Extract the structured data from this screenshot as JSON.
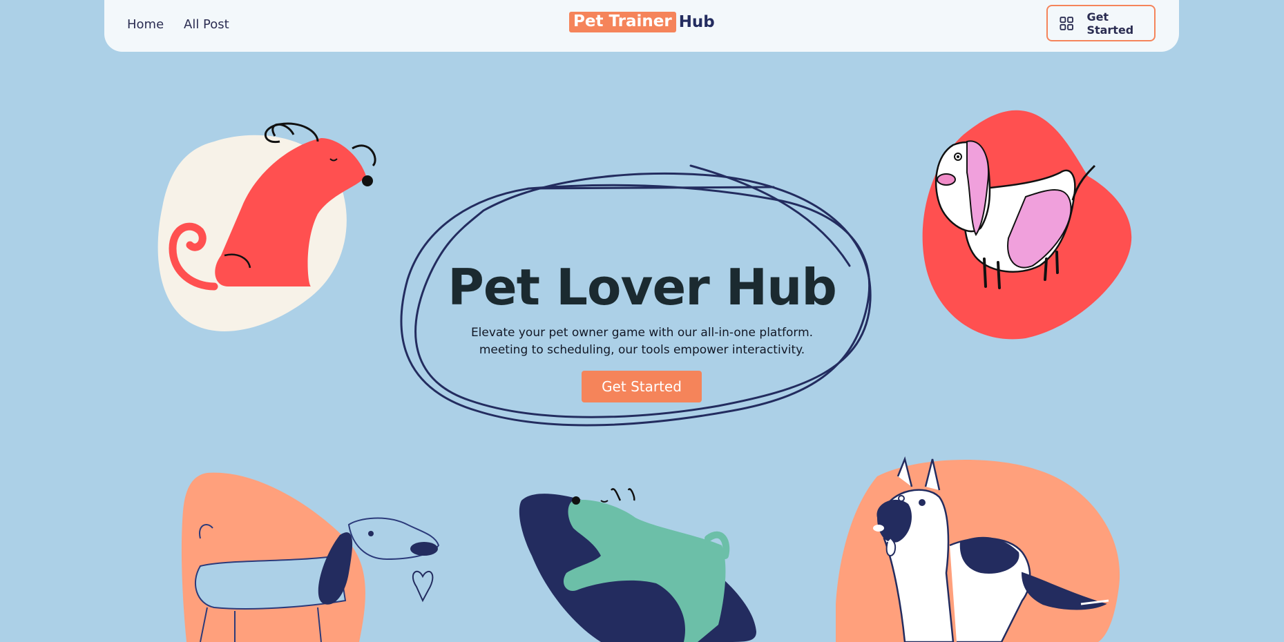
{
  "nav": {
    "links": [
      "Home",
      "All Post"
    ],
    "logo": {
      "part1": "Pet Trainer",
      "part2": "Hub"
    },
    "cta": {
      "label": "Get Started",
      "icon": "grid-icon"
    }
  },
  "hero": {
    "title": "Pet Lover Hub",
    "subtitle_lines": [
      "Elevate your pet owner game with our all-in-one platform.",
      "meeting to scheduling, our tools empower interactivity."
    ],
    "button": "Get Started"
  },
  "illustrations": [
    "red-dog-sitting-illustration",
    "pink-basset-hound-illustration",
    "blue-dog-with-heart-illustration",
    "green-dog-on-surfboard-illustration",
    "white-shepherd-dog-illustration"
  ],
  "colors": {
    "background": "#acd0e7",
    "accent": "#f5845a",
    "navy": "#232c5f",
    "red": "#ff5050"
  }
}
